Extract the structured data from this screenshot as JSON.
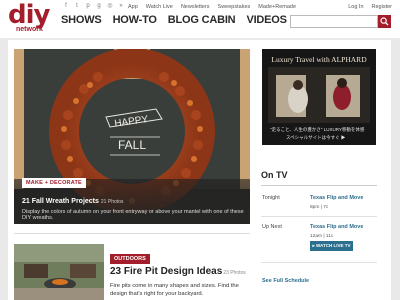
{
  "header": {
    "logo_text": "diy",
    "logo_sub": "network",
    "top_links": [
      "App",
      "Watch Live",
      "Newsletters",
      "Sweepstakes",
      "Made+Remade"
    ],
    "util_links": [
      "Log In",
      "Register"
    ],
    "nav": [
      "SHOWS",
      "HOW-TO",
      "BLOG CABIN",
      "VIDEOS"
    ],
    "social_icons": [
      "facebook-icon",
      "twitter-icon",
      "pinterest-icon",
      "googleplus-icon",
      "instagram-icon",
      "rss-icon"
    ]
  },
  "hero": {
    "tag": "MAKE + DECORATE",
    "title": "21 Fall Wreath Projects",
    "count": "21 Photos",
    "description": "Display the colors of autumn on your front entryway or above your mantel with one of these DIY wreaths."
  },
  "card2": {
    "tag": "OUTDOORS",
    "title": "23 Fire Pit Design Ideas",
    "count": "23 Photos",
    "description": "Fire pits come in many shapes and sizes. Find the design that's right for your backyard."
  },
  "ad": {
    "title": "Luxury Travel with ALPHARD",
    "line1": "\"走ること、人生の豊かさ\" LUXURY移動を体感",
    "line2": "スペシャルサイトは今すぐ ▶"
  },
  "on_tv": {
    "heading": "On TV",
    "rows": [
      {
        "label": "Tonight",
        "show": "Texas Flip and Move",
        "time": "8pm | 7c"
      },
      {
        "label": "Up Next",
        "show": "Texas Flip and Move",
        "time": "12am | 11c"
      }
    ],
    "watch_label": "▸ WATCH LIVE TV",
    "full_schedule": "See Full Schedule"
  },
  "colors": {
    "brand": "#a31d2b",
    "link": "#2b6f8f"
  }
}
